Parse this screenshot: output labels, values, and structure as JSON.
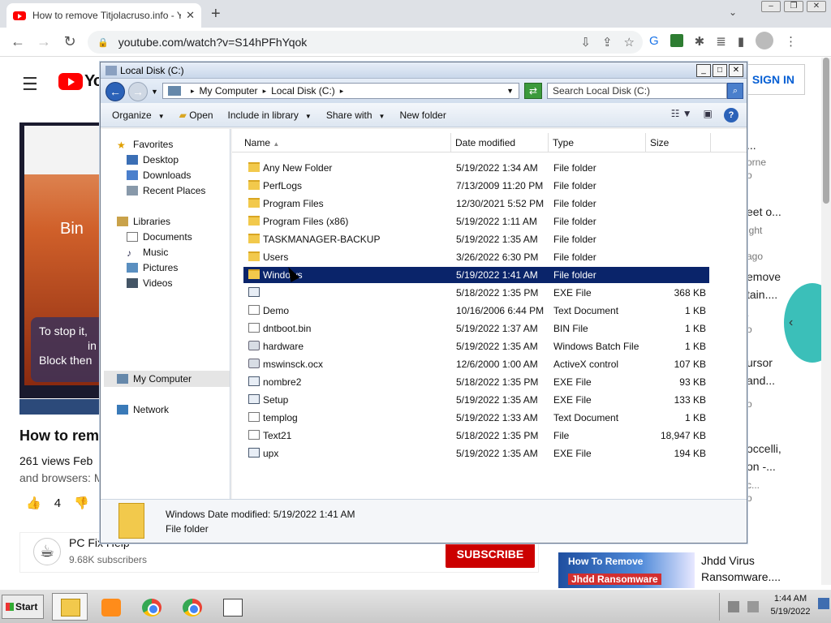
{
  "chrome": {
    "tab_title": "How to remove Titjolacruso.info - Y",
    "url": "youtube.com/watch?v=S14hPFhYqok"
  },
  "youtube": {
    "logo_text": "Yo",
    "signin_label": "SIGN IN",
    "video_title": "How to rem",
    "video_meta": "261 views  Feb",
    "video_desc": "and browsers: M",
    "like_count": "4",
    "dislike_label": "D",
    "thumb_bing": "Bin",
    "thumb_overlay_1": "To stop it,",
    "thumb_overlay_2": "in",
    "thumb_overlay_3": "Block then",
    "channel_name": "PC Fix Help",
    "channel_subs": "9.68K subscribers",
    "subscribe_label": "SUBSCRIBE",
    "rec": [
      {
        "text": "..."
      },
      {
        "text": "orne",
        "sub": true
      },
      {
        "text": "o",
        "sub": true
      },
      {
        "text": "eet o..."
      },
      {
        "text": "ight",
        "sub": true
      },
      {
        "text": "ago",
        "sub": true
      },
      {
        "text": "emove"
      },
      {
        "text": "tain...."
      },
      {
        "text": ".",
        "sub": true
      },
      {
        "text": "o",
        "sub": true
      },
      {
        "text": "ursor"
      },
      {
        "text": "and..."
      },
      {
        "text": "o",
        "sub": true
      },
      {
        "text": "occelli,"
      },
      {
        "text": "on -..."
      },
      {
        "text": "c...",
        "sub": true
      },
      {
        "text": "o",
        "sub": true
      }
    ],
    "bottom_rec_thumb_1": "How To Remove",
    "bottom_rec_thumb_2": "Jhdd Ransomware",
    "bottom_rec_title_1": "Jhdd Virus",
    "bottom_rec_title_2": "Ransomware...."
  },
  "explorer": {
    "window_title": "Local Disk (C:)",
    "breadcrumb": [
      "My Computer",
      "Local Disk (C:)"
    ],
    "search_placeholder": "Search Local Disk (C:)",
    "commands": {
      "organize": "Organize",
      "open": "Open",
      "include": "Include in library",
      "share": "Share with",
      "newfolder": "New folder"
    },
    "nav": {
      "favorites": "Favorites",
      "desktop": "Desktop",
      "downloads": "Downloads",
      "recent": "Recent Places",
      "libraries": "Libraries",
      "documents": "Documents",
      "music": "Music",
      "pictures": "Pictures",
      "videos": "Videos",
      "mycomputer": "My Computer",
      "network": "Network"
    },
    "columns": {
      "name": "Name",
      "date": "Date modified",
      "type": "Type",
      "size": "Size"
    },
    "files": [
      {
        "name": "Any New Folder",
        "date": "5/19/2022 1:34 AM",
        "type": "File folder",
        "size": "",
        "icon": "folder"
      },
      {
        "name": "PerfLogs",
        "date": "7/13/2009 11:20 PM",
        "type": "File folder",
        "size": "",
        "icon": "folder"
      },
      {
        "name": "Program Files",
        "date": "12/30/2021 5:52 PM",
        "type": "File folder",
        "size": "",
        "icon": "folder"
      },
      {
        "name": "Program Files (x86)",
        "date": "5/19/2022 1:11 AM",
        "type": "File folder",
        "size": "",
        "icon": "folder"
      },
      {
        "name": "TASKMANAGER-BACKUP",
        "date": "5/19/2022 1:35 AM",
        "type": "File folder",
        "size": "",
        "icon": "folder"
      },
      {
        "name": "Users",
        "date": "3/26/2022 6:30 PM",
        "type": "File folder",
        "size": "",
        "icon": "folder"
      },
      {
        "name": "Windows",
        "date": "5/19/2022 1:41 AM",
        "type": "File folder",
        "size": "",
        "icon": "folder",
        "selected": true
      },
      {
        "name": "",
        "date": "5/18/2022 1:35 PM",
        "type": "EXE File",
        "size": "368 KB",
        "icon": "exe"
      },
      {
        "name": "Demo",
        "date": "10/16/2006 6:44 PM",
        "type": "Text Document",
        "size": "1 KB",
        "icon": "doc"
      },
      {
        "name": "dntboot.bin",
        "date": "5/19/2022 1:37 AM",
        "type": "BIN File",
        "size": "1 KB",
        "icon": "doc"
      },
      {
        "name": "hardware",
        "date": "5/19/2022 1:35 AM",
        "type": "Windows Batch File",
        "size": "1 KB",
        "icon": "gear"
      },
      {
        "name": "mswinsck.ocx",
        "date": "12/6/2000 1:00 AM",
        "type": "ActiveX control",
        "size": "107 KB",
        "icon": "gear"
      },
      {
        "name": "nombre2",
        "date": "5/18/2022 1:35 PM",
        "type": "EXE File",
        "size": "93 KB",
        "icon": "exe"
      },
      {
        "name": "Setup",
        "date": "5/19/2022 1:35 AM",
        "type": "EXE File",
        "size": "133 KB",
        "icon": "exe"
      },
      {
        "name": "templog",
        "date": "5/19/2022 1:33 AM",
        "type": "Text Document",
        "size": "1 KB",
        "icon": "doc"
      },
      {
        "name": "Text21",
        "date": "5/18/2022 1:35 PM",
        "type": "File",
        "size": "18,947 KB",
        "icon": "doc"
      },
      {
        "name": "upx",
        "date": "5/19/2022 1:35 AM",
        "type": "EXE File",
        "size": "194 KB",
        "icon": "exe"
      }
    ],
    "details": {
      "name_line": "Windows Date modified: 5/19/2022 1:41 AM",
      "type_line": "File folder"
    }
  },
  "taskbar": {
    "start_label": "Start",
    "time": "1:44 AM",
    "date": "5/19/2022"
  }
}
